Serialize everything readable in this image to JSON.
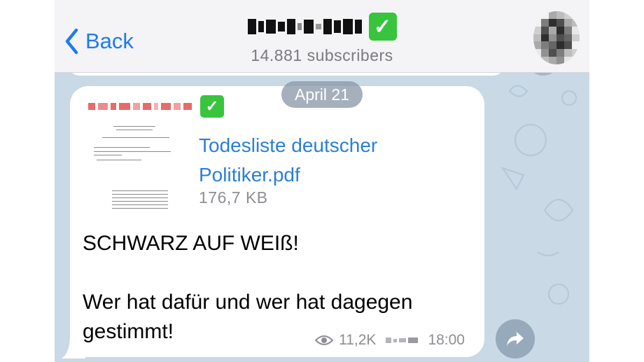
{
  "header": {
    "back_label": "Back",
    "channel_name_obscured": "(pixelated channel name)",
    "subscribers": "14.881 subscribers"
  },
  "chat": {
    "date_pill": "April 21",
    "message": {
      "sender_obscured": "(pixelated sender name)",
      "attachment": {
        "file_name": "Todesliste deutscher Politiker.pdf",
        "file_size": "176,7 KB"
      },
      "text": "SCHWARZ AUF WEIß!\n\nWer hat dafür und wer hat dagegen gestimmt!",
      "views": "11,2K",
      "time": "18:00"
    }
  },
  "colors": {
    "accent": "#1d7bf1",
    "link": "#2b7fd6",
    "verified": "#39c43d",
    "chat_background": "#c9d9e6"
  },
  "icons": [
    "back-chevron-icon",
    "verified-check-icon",
    "eye-icon",
    "share-arrow-icon"
  ]
}
